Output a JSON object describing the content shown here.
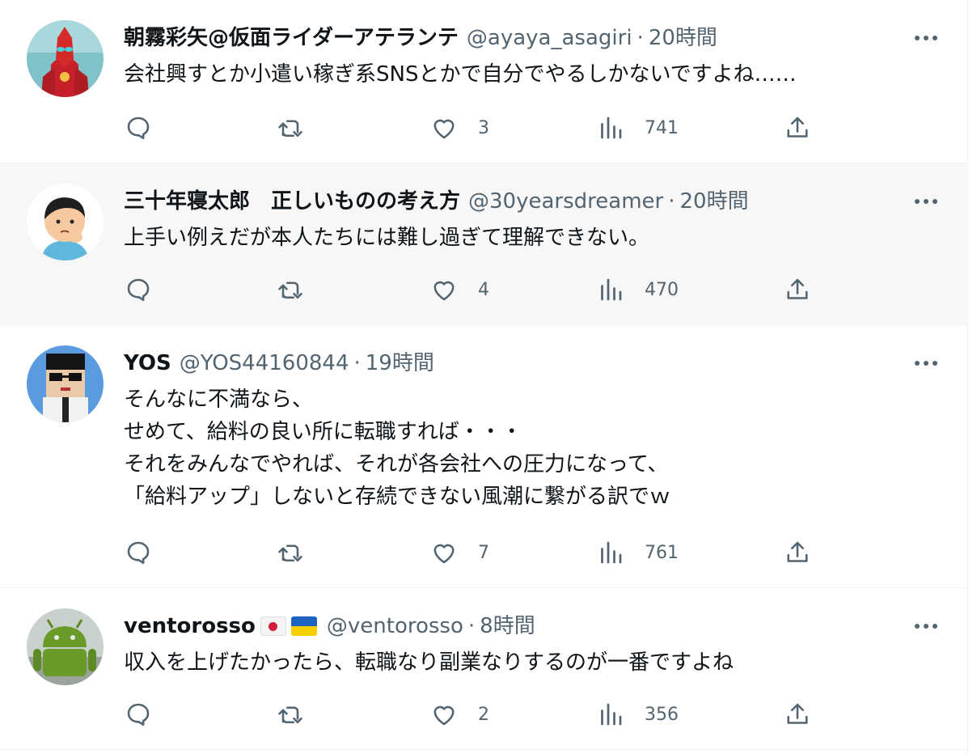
{
  "colors": {
    "text_primary": "#0f1419",
    "text_secondary": "#536471",
    "border": "#eff3f4",
    "hover_background": "#f7f7f7"
  },
  "tweets": [
    {
      "name": "朝霧彩矢@仮面ライダーアテランテ",
      "handle": "@ayaya_asagiri",
      "separator": "·",
      "time": "20時間",
      "lines": [
        "会社興すとか小遣い稼ぎ系SNSとかで自分でやるしかないですよね……"
      ],
      "reply_count": "",
      "retweet_count": "",
      "like_count": "3",
      "view_count": "741",
      "avatar_icon": "red-armored-hero-avatar"
    },
    {
      "name": "三十年寝太郎　正しいものの考え方",
      "handle": "@30yearsdreamer",
      "separator": "·",
      "time": "20時間",
      "lines": [
        "上手い例えだが本人たちには難し過ぎて理解できない。"
      ],
      "reply_count": "",
      "retweet_count": "",
      "like_count": "4",
      "view_count": "470",
      "avatar_icon": "thinking-boy-avatar"
    },
    {
      "name": "YOS",
      "handle": "@YOS44160844",
      "separator": "·",
      "time": "19時間",
      "lines": [
        "そんなに不満なら、",
        "せめて、給料の良い所に転職すれば・・・",
        "それをみんなでやれば、それが各会社への圧力になって、",
        "「給料アップ」しないと存続できない風潮に繋がる訳でｗ"
      ],
      "reply_count": "",
      "retweet_count": "",
      "like_count": "7",
      "view_count": "761",
      "avatar_icon": "pixel-character-avatar"
    },
    {
      "name": "ventorosso",
      "flags": [
        "japan-flag",
        "ukraine-flag"
      ],
      "handle": "@ventorosso",
      "separator": "·",
      "time": "8時間",
      "lines": [
        "収入を上げたかったら、転職なり副業なりするのが一番ですよね"
      ],
      "reply_count": "",
      "retweet_count": "",
      "like_count": "2",
      "view_count": "356",
      "avatar_icon": "green-robot-avatar"
    }
  ]
}
